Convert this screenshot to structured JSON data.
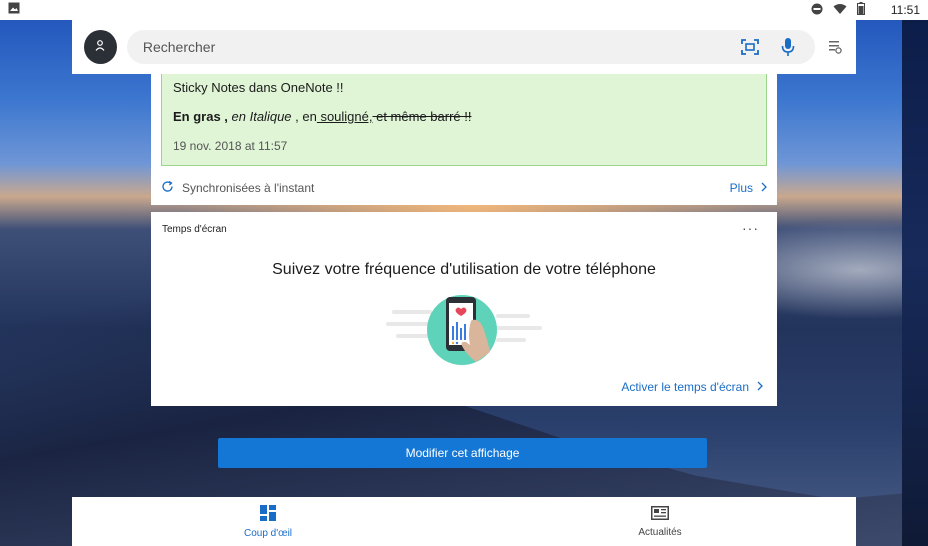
{
  "status_bar": {
    "time": "11:51"
  },
  "search": {
    "placeholder": "Rechercher"
  },
  "notes_card": {
    "note_title": "Sticky Notes dans OneNote !!",
    "body": {
      "bold": "En gras ,",
      "italic": " en Italique",
      "sep1": " , en",
      "underline": " souligné,",
      "strike": " et même barré !!"
    },
    "date": "19 nov. 2018 at 11:57",
    "sync_label": "Synchronisées à l'instant",
    "more_label": "Plus"
  },
  "screen_card": {
    "header": "Temps d'écran",
    "headline": "Suivez votre fréquence d'utilisation de votre téléphone",
    "activate_label": "Activer le temps d'écran"
  },
  "modify_button": {
    "label": "Modifier cet affichage"
  },
  "bottom_nav": {
    "tabs": [
      {
        "label": "Coup d'œil",
        "icon": "grid-icon",
        "active": true
      },
      {
        "label": "Actualités",
        "icon": "news-icon",
        "active": false
      }
    ]
  },
  "colors": {
    "accent": "#1477d6",
    "link": "#1a6dc7",
    "note_bg": "#dff5d6",
    "note_border": "#9cd58a"
  }
}
